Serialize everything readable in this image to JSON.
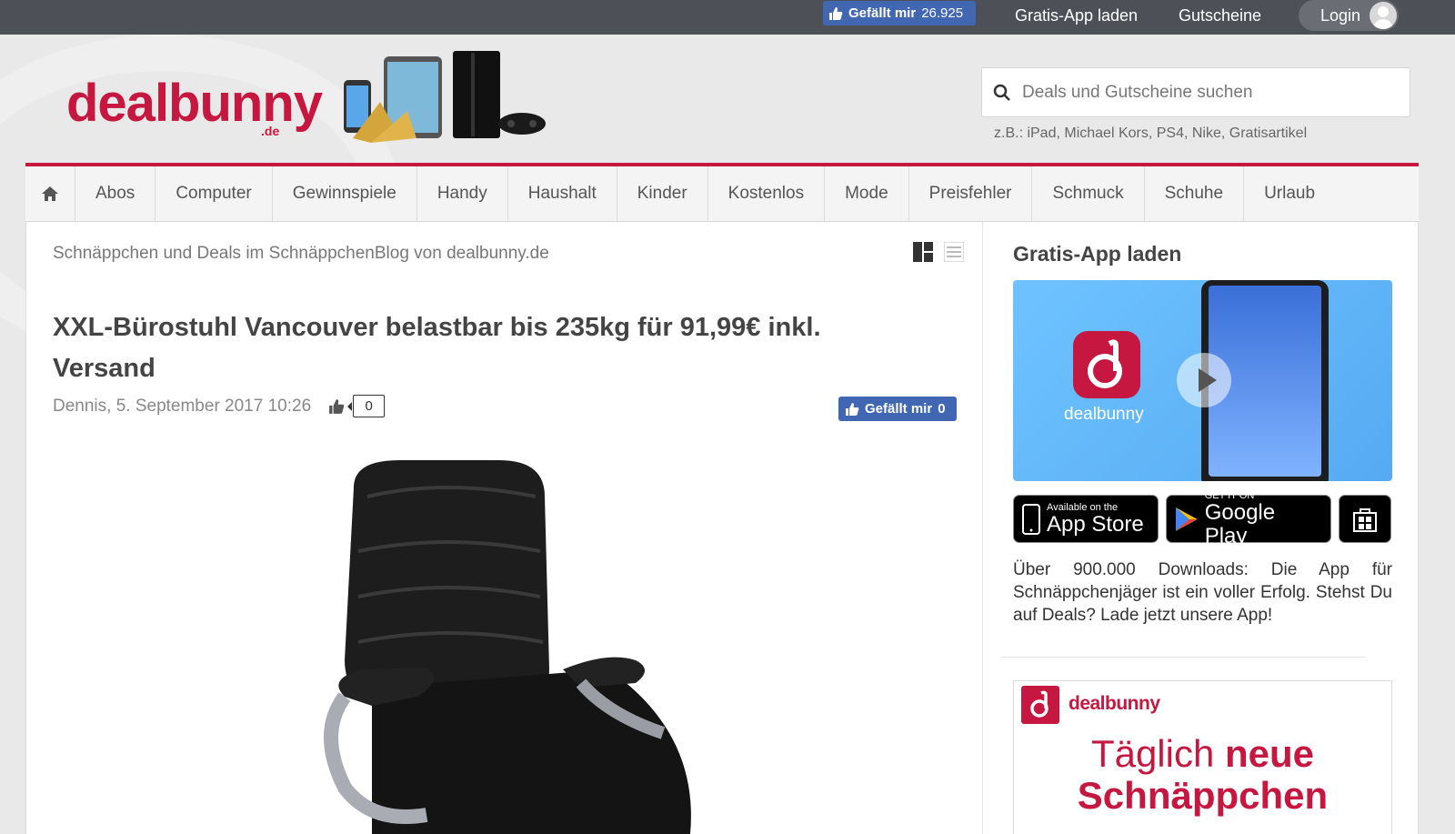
{
  "topbar": {
    "fb_like_label": "Gefällt mir",
    "fb_like_count": "26.925",
    "app_link": "Gratis-App laden",
    "coupons_link": "Gutscheine",
    "login_label": "Login"
  },
  "header": {
    "logo_text": "dealbunny",
    "logo_tld": ".de",
    "search_placeholder": "Deals und Gutscheine suchen",
    "search_hint": "z.B.:  iPad, Michael Kors, PS4, Nike, Gratisartikel"
  },
  "nav": {
    "items": [
      "Abos",
      "Computer",
      "Gewinnspiele",
      "Handy",
      "Haushalt",
      "Kinder",
      "Kostenlos",
      "Mode",
      "Preisfehler",
      "Schmuck",
      "Schuhe",
      "Urlaub"
    ]
  },
  "main": {
    "blog_heading": "Schnäppchen und Deals im SchnäppchenBlog von dealbunny.de",
    "article": {
      "title": "XXL-Bürostuhl Vancouver belastbar bis 235kg für 91,99€ inkl. Versand",
      "meta": "Dennis, 5. September 2017 10:26",
      "comment_count": "0",
      "fb_like_label": "Gefällt mir",
      "fb_like_count": "0"
    }
  },
  "sidebar": {
    "title": "Gratis-App laden",
    "video_brand": "dealbunny",
    "appstore_small": "Available on the",
    "appstore_big": "App Store",
    "googleplay_small": "GET IT ON",
    "googleplay_big": "Google Play",
    "description": "Über 900.000 Downloads: Die App für Schnäppchenjäger ist ein voller Erfolg. Stehst Du auf Deals? Lade jetzt unsere App!",
    "promo_brand": "dealbunny",
    "promo_line1_a": "Täglich",
    "promo_line1_b": "neue",
    "promo_line2": "Schnäppchen"
  },
  "colors": {
    "brand": "#c5173f",
    "facebook": "#4267b2",
    "topbar": "#4d5057"
  }
}
